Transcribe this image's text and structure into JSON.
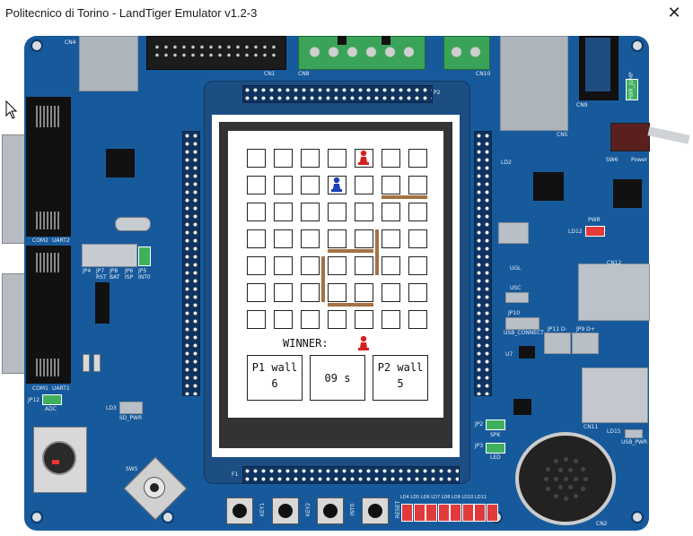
{
  "window": {
    "title": "Politecnico di Torino - LandTiger Emulator v1.2-3",
    "close_glyph": "✕"
  },
  "board": {
    "silk": {
      "cn4": "CN4",
      "cn1": "CN1",
      "cn8": "CN8",
      "cn10": "CN10",
      "cn9": "CN9",
      "cn5": "CN5",
      "cn12": "CN12",
      "cn11": "CN11",
      "cn2": "CN2",
      "com2": "COM2",
      "uart2": "UART2",
      "com1": "COM1",
      "uart1": "UART1",
      "jp12": "JP12",
      "adc": "ADC",
      "sw5": "SW5",
      "sw6": "SW6",
      "power": "Power",
      "pwr": "PWR",
      "ld12": "LD12",
      "ld3": "LD3",
      "sd_pwr": "SD_PWR",
      "jp4": "JP4",
      "jp7": "JP7",
      "jp8": "JP8",
      "jp6": "JP6",
      "jp5": "JP5",
      "rst": "RST",
      "bat": "BAT",
      "isp": "ISP",
      "int0": "INT0",
      "ld2": "LD2",
      "ugl": "UGL",
      "usc": "USC",
      "jp10": "JP10",
      "usb_connect": "USB_CONNECT",
      "jp11": "JP11 D-",
      "jp9": "JP9 D+",
      "u7": "U7",
      "jp2": "JP2",
      "spk": "SPK",
      "jp3": "JP3",
      "led": "LED",
      "ld15": "LD15",
      "usb_pwr": "USB_PWR",
      "f1": "F1",
      "p2": "P2",
      "key1": "KEY1",
      "key2": "KEY2",
      "int0_btn": "INT0",
      "reset": "RESET",
      "leds": "LD4 LD5 LD6 LD7 LD8 LD9 LD10 LD11",
      "pwr_jump": "PWR_JUMP"
    }
  },
  "game": {
    "winner_label": "WINNER:",
    "p1": {
      "label": "P1 wall",
      "walls": "6"
    },
    "timer": "09 s",
    "p2": {
      "label": "P2 wall",
      "walls": "5"
    }
  },
  "colors": {
    "board": "#175a9c",
    "wall": "#a47244",
    "player1": "#d62020",
    "player2": "#1a3fb8"
  },
  "icons": {
    "player1_pawn": "red-pawn-icon",
    "player2_pawn": "blue-pawn-icon",
    "winner_pawn": "red-pawn-icon",
    "close": "close-icon",
    "mouse_cursor": "cursor-icon"
  }
}
